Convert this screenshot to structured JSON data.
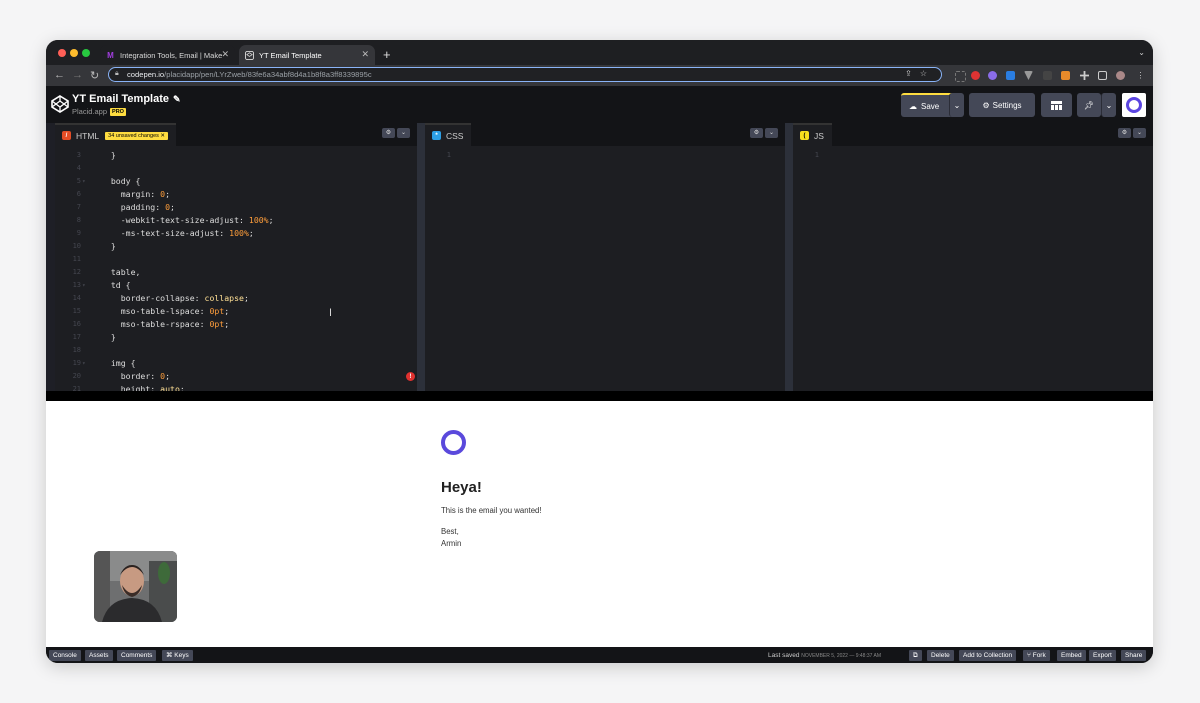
{
  "browser": {
    "tabs": [
      {
        "title": "Integration Tools, Email | Make",
        "active": false
      },
      {
        "title": "YT Email Template",
        "active": true
      }
    ],
    "new_tab": "+",
    "url_domain": "codepen.io",
    "url_path": "/placidapp/pen/LYrZweb/83fe6a34abf8d4a1b8f8a3ff8339895c"
  },
  "header": {
    "pen_title": "YT Email Template",
    "owner": "Placid.app",
    "pro_badge": "PRO",
    "save_label": "Save",
    "settings_label": "Settings"
  },
  "panes": {
    "html": {
      "label": "HTML",
      "badge": "34 unsaved changes"
    },
    "css": {
      "label": "CSS",
      "first_line": "1"
    },
    "js": {
      "label": "JS",
      "first_line": "1"
    }
  },
  "code_lines": [
    {
      "n": "3",
      "text": "  }"
    },
    {
      "n": "4",
      "text": ""
    },
    {
      "n": "5",
      "text": "  body {",
      "fold": true
    },
    {
      "n": "6",
      "text": "    margin: 0;"
    },
    {
      "n": "7",
      "text": "    padding: 0;"
    },
    {
      "n": "8",
      "text": "    -webkit-text-size-adjust: 100%;"
    },
    {
      "n": "9",
      "text": "    -ms-text-size-adjust: 100%;"
    },
    {
      "n": "10",
      "text": "  }"
    },
    {
      "n": "11",
      "text": ""
    },
    {
      "n": "12",
      "text": "  table,"
    },
    {
      "n": "13",
      "text": "  td {",
      "fold": true
    },
    {
      "n": "14",
      "text": "    border-collapse: collapse;"
    },
    {
      "n": "15",
      "text": "    mso-table-lspace: 0pt;"
    },
    {
      "n": "16",
      "text": "    mso-table-rspace: 0pt;"
    },
    {
      "n": "17",
      "text": "  }"
    },
    {
      "n": "18",
      "text": ""
    },
    {
      "n": "19",
      "text": "  img {",
      "fold": true
    },
    {
      "n": "20",
      "text": "    border: 0;"
    },
    {
      "n": "21",
      "text": "    height: auto;"
    }
  ],
  "preview": {
    "heading": "Heya!",
    "body": "This is the email you wanted!",
    "signoff": "Best,",
    "signature": "Armin"
  },
  "footer": {
    "left_buttons": [
      "Console",
      "Assets",
      "Comments",
      "⌘ Keys"
    ],
    "last_saved_label": "Last saved",
    "last_saved_time": "NOVEMBER 5, 2022 — 9:48:37 AM",
    "right_buttons": [
      "Delete",
      "Add to Collection",
      "Fork",
      "Embed",
      "Export",
      "Share"
    ]
  },
  "colors": {
    "brand_purple": "#5a49dc",
    "pro_yellow": "#ffdd40",
    "html_red": "#e44d26",
    "css_blue": "#2d9fe5",
    "js_yellow": "#f7df1e"
  },
  "icons": [
    "codepen-logo-icon",
    "cloud-icon",
    "gear-icon",
    "layout-icon",
    "pin-icon",
    "chevron-down-icon",
    "error-icon"
  ]
}
